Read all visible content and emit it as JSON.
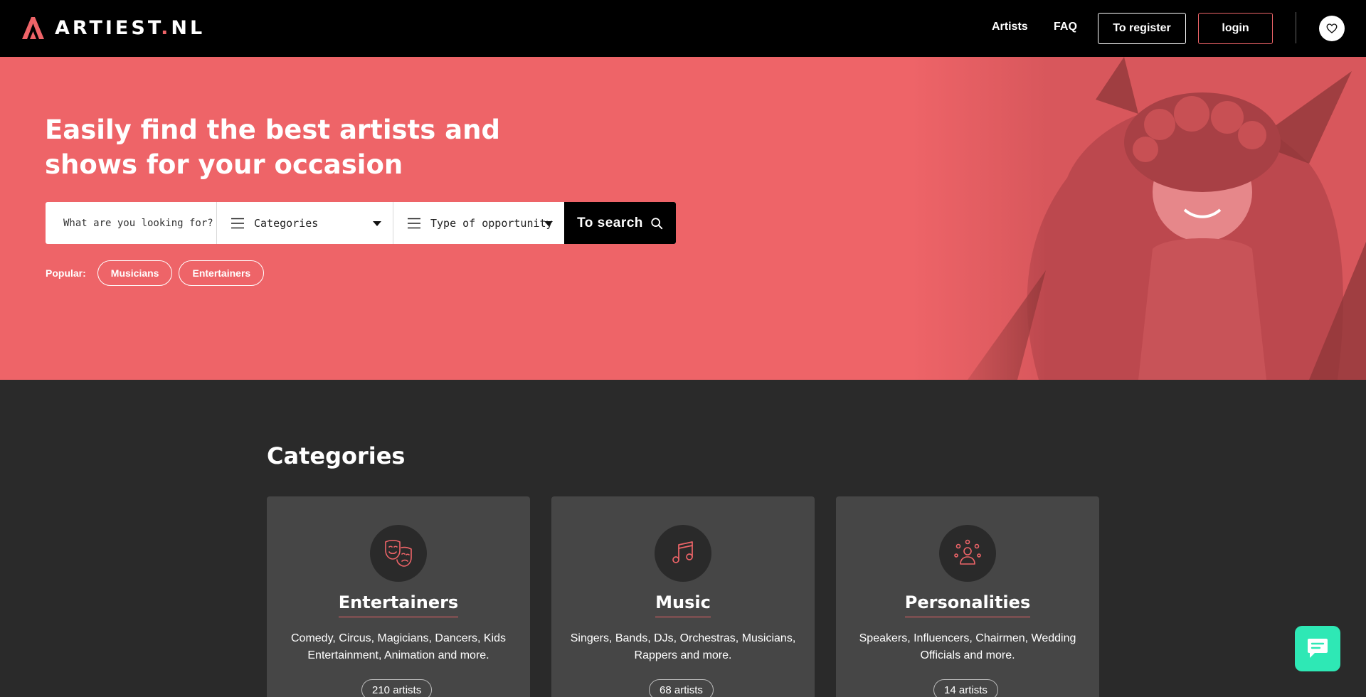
{
  "header": {
    "logo_text": "ARTIEST",
    "logo_dot": ".",
    "logo_suffix": "NL",
    "nav": [
      {
        "label": "Artists"
      },
      {
        "label": "FAQ"
      }
    ],
    "register_label": "To register",
    "login_label": "login"
  },
  "hero": {
    "title": "Easily find the best artists and shows for your occasion",
    "search_placeholder": "What are you looking for?",
    "categories_label": "Categories",
    "opportunity_label": "Type of opportunity",
    "search_button": "To search",
    "popular_label": "Popular:",
    "popular_tags": [
      "Musicians",
      "Entertainers"
    ]
  },
  "categories": {
    "title": "Categories",
    "cards": [
      {
        "name": "Entertainers",
        "desc": "Comedy, Circus, Magicians, Dancers, Kids Entertainment, Animation and more.",
        "count": "210 artists",
        "icon": "theater-masks-icon"
      },
      {
        "name": "Music",
        "desc": "Singers, Bands, DJs, Orchestras, Musicians, Rappers and more.",
        "count": "68 artists",
        "icon": "music-note-icon"
      },
      {
        "name": "Personalities",
        "desc": "Speakers, Influencers, Chairmen, Wedding Officials and more.",
        "count": "14 artists",
        "icon": "speaker-person-icon"
      }
    ]
  },
  "colors": {
    "accent": "#ee6468",
    "header_bg": "#000000",
    "page_bg": "#2a2a2a",
    "card_bg": "#464646",
    "chat": "#2ee8b5"
  }
}
